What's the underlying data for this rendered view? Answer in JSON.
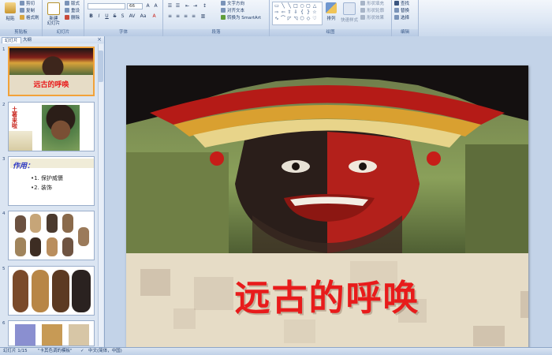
{
  "ribbon": {
    "clipboard": {
      "paste": "粘贴",
      "cut": "剪切",
      "copy": "复制",
      "painter": "格式刷",
      "caption": "剪贴板"
    },
    "slides": {
      "new_slide": "新建\n幻灯片",
      "layout": "版式",
      "reset": "重设",
      "delete": "删除",
      "caption": "幻灯片"
    },
    "font": {
      "font_name": "",
      "font_size": "66",
      "caption": "字体"
    },
    "paragraph": {
      "text_dir": "文字方向",
      "align_text": "对齐文本",
      "smartart": "转换为 SmartArt",
      "caption": "段落"
    },
    "drawing": {
      "arrange": "排列",
      "quick_styles": "快速样式",
      "fill": "形状填充",
      "outline": "形状轮廓",
      "effects": "形状效果",
      "caption": "绘图"
    },
    "editing": {
      "find": "查找",
      "replace": "替换",
      "select": "选择",
      "caption": "编辑"
    }
  },
  "panel": {
    "tabs": [
      "幻灯片",
      "大纲"
    ],
    "close": "×",
    "thumbnails": [
      {
        "num": "1",
        "title": "远古的呼唤"
      },
      {
        "num": "2",
        "text": "土著来啦"
      },
      {
        "num": "3",
        "heading": "作用：",
        "items": [
          "•1. 保护威慑",
          "•2. 装饰"
        ]
      },
      {
        "num": "4"
      },
      {
        "num": "5"
      },
      {
        "num": "6"
      }
    ]
  },
  "slide": {
    "title": "远古的呼唤"
  },
  "status": {
    "slide_info": "幻灯片 1/15",
    "theme": "\"卡其色调的模板\"",
    "language": "中文(简体，中国)"
  }
}
